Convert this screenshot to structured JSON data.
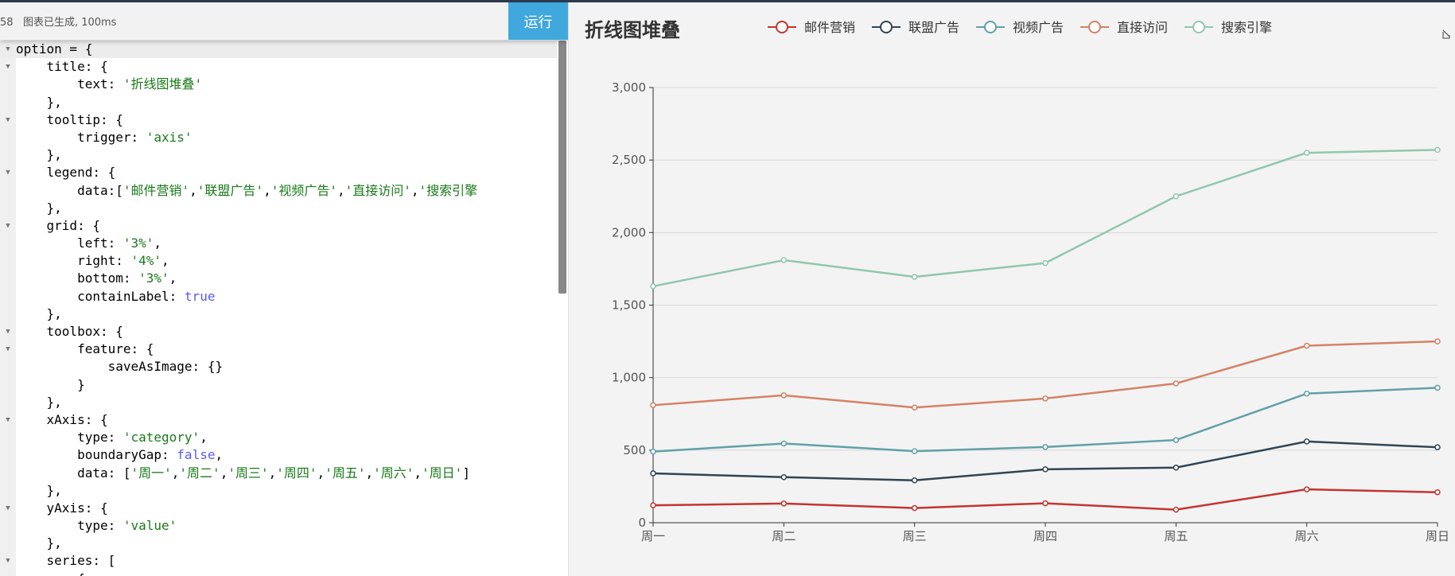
{
  "toolbar": {
    "status": "58   图表已生成, 100ms",
    "run_label": "运行"
  },
  "code_lines": [
    [
      [
        "k",
        "option = {"
      ]
    ],
    [
      [
        "k",
        "    title: {"
      ]
    ],
    [
      [
        "k",
        "        text: "
      ],
      [
        "s",
        "'折线图堆叠'"
      ]
    ],
    [
      [
        "k",
        "    },"
      ]
    ],
    [
      [
        "k",
        "    tooltip: {"
      ]
    ],
    [
      [
        "k",
        "        trigger: "
      ],
      [
        "s",
        "'axis'"
      ]
    ],
    [
      [
        "k",
        "    },"
      ]
    ],
    [
      [
        "k",
        "    legend: {"
      ]
    ],
    [
      [
        "k",
        "        data:["
      ],
      [
        "s",
        "'邮件营销'"
      ],
      [
        "k",
        ","
      ],
      [
        "s",
        "'联盟广告'"
      ],
      [
        "k",
        ","
      ],
      [
        "s",
        "'视频广告'"
      ],
      [
        "k",
        ","
      ],
      [
        "s",
        "'直接访问'"
      ],
      [
        "k",
        ","
      ],
      [
        "s",
        "'搜索引擎"
      ]
    ],
    [
      [
        "k",
        "    },"
      ]
    ],
    [
      [
        "k",
        "    grid: {"
      ]
    ],
    [
      [
        "k",
        "        left: "
      ],
      [
        "s",
        "'3%'"
      ],
      [
        "k",
        ","
      ]
    ],
    [
      [
        "k",
        "        right: "
      ],
      [
        "s",
        "'4%'"
      ],
      [
        "k",
        ","
      ]
    ],
    [
      [
        "k",
        "        bottom: "
      ],
      [
        "s",
        "'3%'"
      ],
      [
        "k",
        ","
      ]
    ],
    [
      [
        "k",
        "        containLabel: "
      ],
      [
        "b",
        "true"
      ]
    ],
    [
      [
        "k",
        "    },"
      ]
    ],
    [
      [
        "k",
        "    toolbox: {"
      ]
    ],
    [
      [
        "k",
        "        feature: {"
      ]
    ],
    [
      [
        "k",
        "            saveAsImage: {}"
      ]
    ],
    [
      [
        "k",
        "        }"
      ]
    ],
    [
      [
        "k",
        "    },"
      ]
    ],
    [
      [
        "k",
        "    xAxis: {"
      ]
    ],
    [
      [
        "k",
        "        type: "
      ],
      [
        "s",
        "'category'"
      ],
      [
        "k",
        ","
      ]
    ],
    [
      [
        "k",
        "        boundaryGap: "
      ],
      [
        "b",
        "false"
      ],
      [
        "k",
        ","
      ]
    ],
    [
      [
        "k",
        "        data: ["
      ],
      [
        "s",
        "'周一'"
      ],
      [
        "k",
        ","
      ],
      [
        "s",
        "'周二'"
      ],
      [
        "k",
        ","
      ],
      [
        "s",
        "'周三'"
      ],
      [
        "k",
        ","
      ],
      [
        "s",
        "'周四'"
      ],
      [
        "k",
        ","
      ],
      [
        "s",
        "'周五'"
      ],
      [
        "k",
        ","
      ],
      [
        "s",
        "'周六'"
      ],
      [
        "k",
        ","
      ],
      [
        "s",
        "'周日'"
      ],
      [
        "k",
        "]"
      ]
    ],
    [
      [
        "k",
        "    },"
      ]
    ],
    [
      [
        "k",
        "    yAxis: {"
      ]
    ],
    [
      [
        "k",
        "        type: "
      ],
      [
        "s",
        "'value'"
      ]
    ],
    [
      [
        "k",
        "    },"
      ]
    ],
    [
      [
        "k",
        "    series: ["
      ]
    ],
    [
      [
        "k",
        "        {"
      ]
    ]
  ],
  "fold_lines": [
    0,
    1,
    4,
    7,
    10,
    16,
    17,
    21,
    26,
    29
  ],
  "chart_data": {
    "type": "line",
    "title": "折线图堆叠",
    "categories": [
      "周一",
      "周二",
      "周三",
      "周四",
      "周五",
      "周六",
      "周日"
    ],
    "ylim": [
      0,
      3000
    ],
    "yticks": [
      0,
      500,
      1000,
      1500,
      2000,
      2500,
      3000
    ],
    "ytick_labels": [
      "0",
      "500",
      "1,000",
      "1,500",
      "2,000",
      "2,500",
      "3,000"
    ],
    "stacked": true,
    "legend_position": "top",
    "series": [
      {
        "name": "邮件营销",
        "color": "#c23531",
        "values": [
          120,
          132,
          101,
          134,
          90,
          230,
          210
        ]
      },
      {
        "name": "联盟广告",
        "color": "#2f4554",
        "values": [
          220,
          182,
          191,
          234,
          290,
          330,
          310
        ]
      },
      {
        "name": "视频广告",
        "color": "#61a0a8",
        "values": [
          150,
          232,
          201,
          154,
          190,
          330,
          410
        ]
      },
      {
        "name": "直接访问",
        "color": "#d48265",
        "values": [
          320,
          332,
          301,
          334,
          390,
          330,
          320
        ]
      },
      {
        "name": "搜索引擎",
        "color": "#91c7ae",
        "values": [
          820,
          932,
          901,
          934,
          1290,
          1330,
          1320
        ]
      }
    ]
  }
}
